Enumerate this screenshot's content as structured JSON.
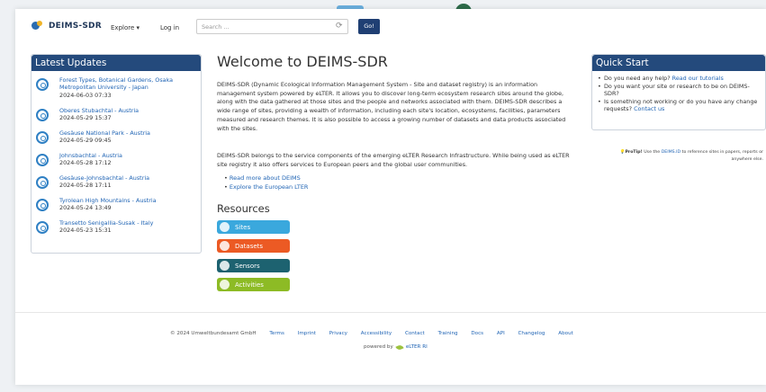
{
  "nav": {
    "logo_text": "DEIMS-SDR",
    "explore": "Explore ▾",
    "login": "Log in",
    "search_placeholder": "Search ...",
    "go": "Go!"
  },
  "latest": {
    "title": "Latest Updates",
    "items": [
      {
        "title": "Forest Types, Botanical Gardens, Osaka Metropolitan University - Japan",
        "date": "2024-06-03 07:33"
      },
      {
        "title": "Oberes Stubachtal - Austria",
        "date": "2024-05-29 15:37"
      },
      {
        "title": "Gesäuse National Park - Austria",
        "date": "2024-05-29 09:45"
      },
      {
        "title": "Johnsbachtal - Austria",
        "date": "2024-05-28 17:12"
      },
      {
        "title": "Gesäuse-Johnsbachtal - Austria",
        "date": "2024-05-28 17:11"
      },
      {
        "title": "Tyrolean High Mountains - Austria",
        "date": "2024-05-24 13:49"
      },
      {
        "title": "Transetto Senigallia-Susak - Italy",
        "date": "2024-05-23 15:31"
      }
    ]
  },
  "main": {
    "title": "Welcome to DEIMS-SDR",
    "para1": "DEIMS-SDR (Dynamic Ecological Information Management System - Site and dataset registry) is an information management system powered by eLTER. It allows you to discover long-term ecosystem research sites around the globe, along with the data gathered at those sites and the people and networks associated with them. DEIMS-SDR describes a wide range of sites, providing a wealth of information, including each site's location, ecosystems, facilities, parameters measured and research themes. It is also possible to access a growing number of datasets and data products associated with the sites.",
    "para2": "DEIMS-SDR belongs to the service components of the emerging eLTER Research Infrastructure. While being used as eLTER site registry it also offers services to European peers and the global user communities.",
    "link1": "Read more about DEIMS",
    "link2": "Explore the European LTER",
    "resources_title": "Resources",
    "resources": [
      {
        "label": "Sites",
        "color": "#3aa8dd"
      },
      {
        "label": "Datasets",
        "color": "#ec5a24"
      },
      {
        "label": "Sensors",
        "color": "#1d6270"
      },
      {
        "label": "Activities",
        "color": "#8dbb25"
      }
    ]
  },
  "quick": {
    "title": "Quick Start",
    "q1_text": "Do you need any help?",
    "q1_link": "Read our tutorials",
    "q2_text": "Do you want your site or research to be on DEIMS-SDR?",
    "q3_text": "Is something not working or do you have any change requests?",
    "q3_link": "Contact us",
    "protip_label": "ProTip!",
    "protip_pre": "Use the",
    "protip_link": "DEIMS.ID",
    "protip_post": "to reference sites in papers, reports or anywhere else."
  },
  "footer": {
    "copyright": "© 2024 Umweltbundesamt GmbH",
    "links": [
      "Terms",
      "Imprint",
      "Privacy",
      "Accessibility",
      "Contact",
      "Training",
      "Docs",
      "API",
      "Changelog",
      "About"
    ],
    "powered_by": "powered by",
    "brand": "eLTER RI"
  },
  "colors": {
    "header_blue": "#244a7c",
    "link": "#2165b5",
    "go_button": "#1f3f73"
  }
}
